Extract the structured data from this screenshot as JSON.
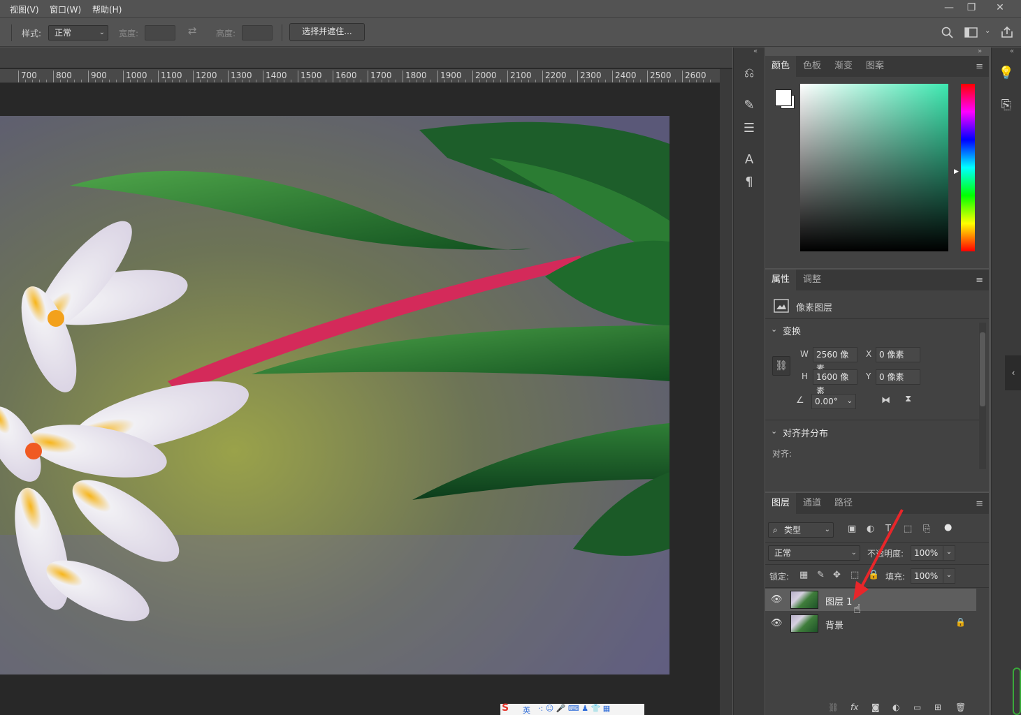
{
  "menu": {
    "items": [
      "视图(V)",
      "窗口(W)",
      "帮助(H)"
    ],
    "window_buttons": {
      "minimize": "—",
      "restore": "❐",
      "close": "✕"
    }
  },
  "options_bar": {
    "style_label": "样式:",
    "style_value": "正常",
    "width_label": "宽度:",
    "height_label": "高度:",
    "select_mask_button": "选择并遮住..."
  },
  "ruler": {
    "ticks": [
      "700",
      "800",
      "900",
      "1000",
      "1100",
      "1200",
      "1300",
      "1400",
      "1500",
      "1600",
      "1700",
      "1800",
      "1900",
      "2000",
      "2100",
      "2200",
      "2300",
      "2400",
      "2500",
      "2600"
    ]
  },
  "color_panel": {
    "tabs": [
      "颜色",
      "色板",
      "渐变",
      "图案"
    ],
    "accent": "#3de8b0"
  },
  "properties_panel": {
    "tabs": [
      "属性",
      "调整"
    ],
    "layer_type": "像素图层",
    "transform_title": "变换",
    "w_label": "W",
    "w_value": "2560 像素",
    "h_label": "H",
    "h_value": "1600 像素",
    "x_label": "X",
    "x_value": "0 像素",
    "y_label": "Y",
    "y_value": "0 像素",
    "angle_value": "0.00°",
    "align_title": "对齐并分布",
    "align_label": "对齐:"
  },
  "layers_panel": {
    "tabs": [
      "图层",
      "通道",
      "路径"
    ],
    "filter_kind": "类型",
    "blend_mode": "正常",
    "opacity_label": "不透明度:",
    "opacity_value": "100%",
    "lock_label": "锁定:",
    "fill_label": "填充:",
    "fill_value": "100%",
    "layers": [
      {
        "name": "图层 1",
        "selected": true,
        "locked": false
      },
      {
        "name": "背景",
        "selected": false,
        "locked": true
      }
    ]
  },
  "taskbar_ime": {
    "label": "英"
  }
}
